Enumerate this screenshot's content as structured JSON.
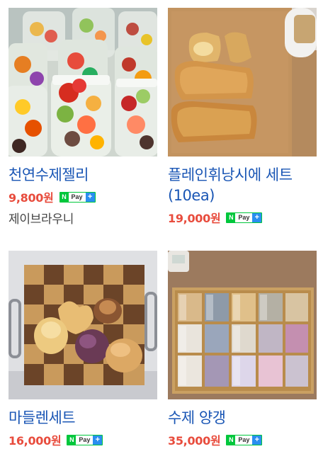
{
  "products": [
    {
      "name": "천연수제젤리",
      "price": "9,800원",
      "npay": {
        "n": "N",
        "pay": "Pay",
        "plus": "+"
      },
      "seller": "제이브라우니"
    },
    {
      "name": "플레인휘낭시에 세트(10ea)",
      "price": "19,000원",
      "npay": {
        "n": "N",
        "pay": "Pay",
        "plus": "+"
      }
    },
    {
      "name": "마들렌세트",
      "price": "16,000원",
      "npay": {
        "n": "N",
        "pay": "Pay",
        "plus": "+"
      }
    },
    {
      "name": "수제 양갱",
      "price": "35,000원",
      "npay": {
        "n": "N",
        "pay": "Pay",
        "plus": "+"
      }
    }
  ],
  "colors": {
    "name": "#1a56b5",
    "price": "#e84c3d",
    "npay_green": "#00c73c",
    "npay_blue": "#2a8ef0"
  }
}
